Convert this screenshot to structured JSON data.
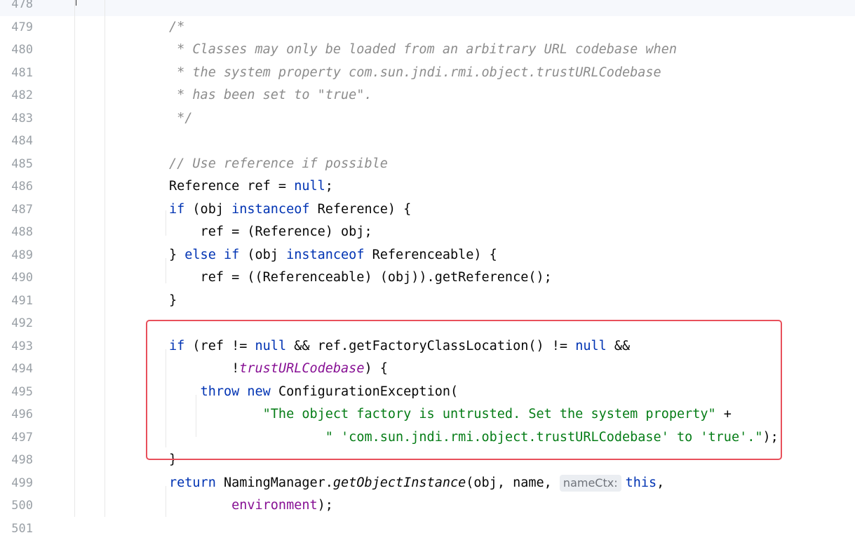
{
  "editor": {
    "lines": [
      {
        "num": "478",
        "html": ""
      },
      {
        "num": "479",
        "html": "<span class=\"cmt\">/*</span>"
      },
      {
        "num": "480",
        "html": "<span class=\"cmt\"> * Classes may only be loaded from an arbitrary URL codebase when</span>"
      },
      {
        "num": "481",
        "html": "<span class=\"cmt\"> * the system property com.sun.jndi.rmi.object.trustURLCodebase</span>"
      },
      {
        "num": "482",
        "html": "<span class=\"cmt\"> * has been set to \"true\".</span>"
      },
      {
        "num": "483",
        "html": "<span class=\"cmt\"> */</span>"
      },
      {
        "num": "484",
        "html": ""
      },
      {
        "num": "485",
        "html": "<span class=\"cmt\">// Use reference if possible</span>"
      },
      {
        "num": "486",
        "html": "Reference ref = <span class=\"kw\">null</span>;"
      },
      {
        "num": "487",
        "html": "<span class=\"kw\">if</span> (obj <span class=\"kw\">instanceof</span> Reference) {"
      },
      {
        "num": "488",
        "html": "    ref = (Reference) obj;"
      },
      {
        "num": "489",
        "html": "} <span class=\"kw\">else if</span> (obj <span class=\"kw\">instanceof</span> Referenceable) {"
      },
      {
        "num": "490",
        "html": "    ref = ((Referenceable) (obj)).getReference();"
      },
      {
        "num": "491",
        "html": "}"
      },
      {
        "num": "492",
        "html": ""
      },
      {
        "num": "493",
        "html": "<span class=\"kw\">if</span> (ref != <span class=\"kw\">null</span> &amp;&amp; ref.getFactoryClassLocation() != <span class=\"kw\">null</span> &amp;&amp;"
      },
      {
        "num": "494",
        "html": "        !<span class=\"field\">trustURLCodebase</span>) {"
      },
      {
        "num": "495",
        "html": "    <span class=\"kw\">throw new</span> ConfigurationException("
      },
      {
        "num": "496",
        "html": "            <span class=\"str\">\"The object factory is untrusted. Set the system property\"</span> +"
      },
      {
        "num": "497",
        "html": "                    <span class=\"str\">\" 'com.sun.jndi.rmi.object.trustURLCodebase' to 'true'.\"</span>);"
      },
      {
        "num": "498",
        "html": "}"
      },
      {
        "num": "499",
        "html": "<span class=\"kw\">return</span> NamingManager.<span class=\"ital\">getObjectInstance</span>(obj, name, <span class=\"hint\" data-name=\"parameter-hint\">nameCtx:</span><span class=\"kw\">this</span>,"
      },
      {
        "num": "500",
        "html": "        <span class=\"field2\">environment</span>);"
      },
      {
        "num": "501",
        "html": ""
      }
    ],
    "hint_color": "#6f737a",
    "keyword_color": "#0033b3",
    "string_color": "#067d17",
    "comment_color": "#8c8c8c",
    "highlight_color": "#e8505b"
  }
}
